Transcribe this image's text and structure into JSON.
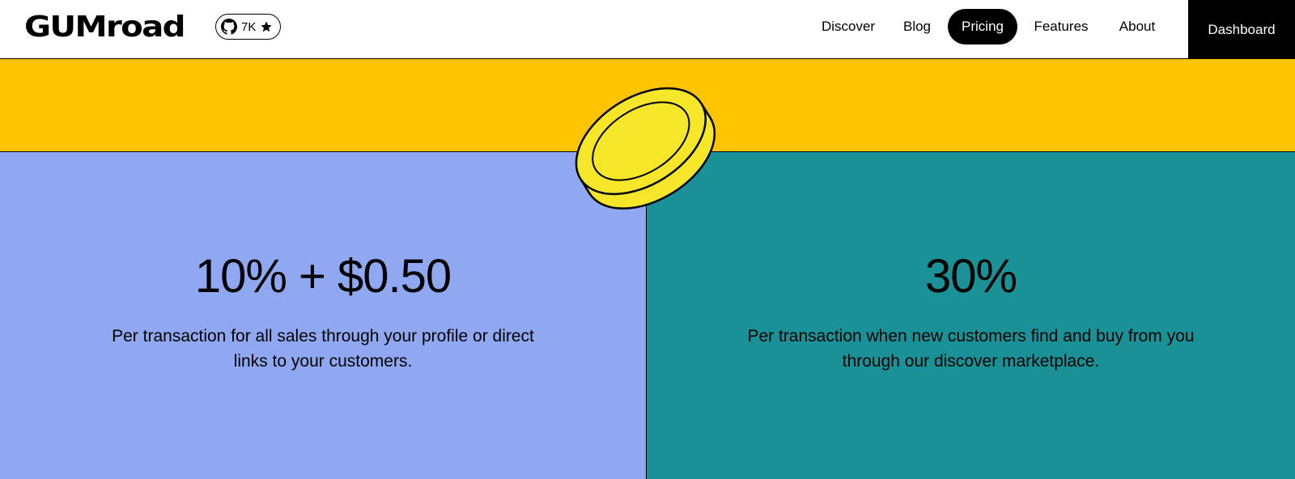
{
  "brand": {
    "name": "GUMroad"
  },
  "github_badge": {
    "count": "7K",
    "icon": "github-icon",
    "star_icon": "star-icon"
  },
  "nav": {
    "items": [
      {
        "label": "Discover",
        "active": false
      },
      {
        "label": "Blog",
        "active": false
      },
      {
        "label": "Pricing",
        "active": true
      },
      {
        "label": "Features",
        "active": false
      },
      {
        "label": "About",
        "active": false
      }
    ],
    "cta_label": "Dashboard"
  },
  "pricing": {
    "left": {
      "price": "10% + $0.50",
      "description": "Per transaction for all sales through your profile or direct links to your customers."
    },
    "right": {
      "price": "30%",
      "description": "Per transaction when new customers find and buy from you through our discover marketplace."
    }
  },
  "colors": {
    "yellow_band": "#ffc400",
    "left_panel": "#8fa8f1",
    "right_panel": "#1a9196",
    "coin": "#f5e62a",
    "nav_active": "#000000"
  }
}
